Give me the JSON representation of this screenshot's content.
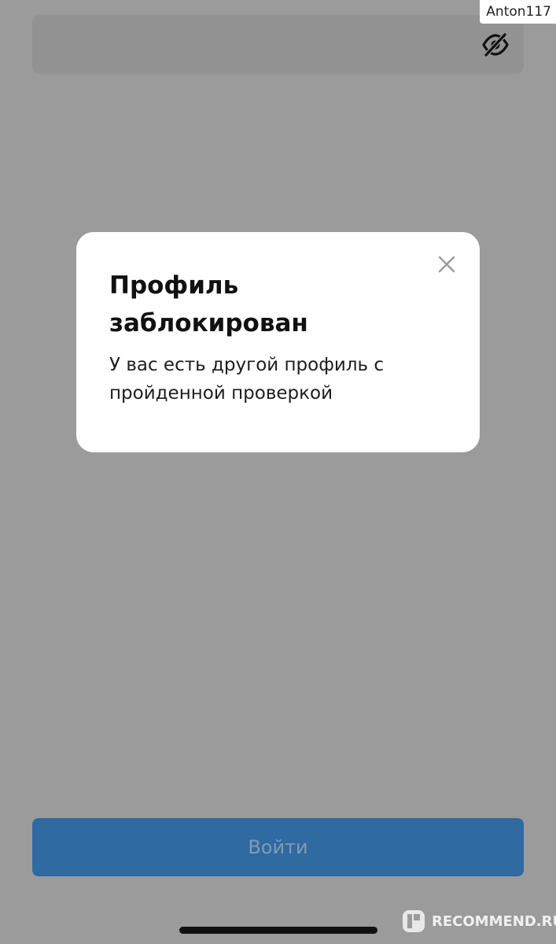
{
  "watermark": {
    "username": "Anton117",
    "brand": "RECOMMEND.RU"
  },
  "password_field": {
    "icon": "eye-slash-icon"
  },
  "modal": {
    "title": "Профиль заблокирован",
    "message": "У вас есть другой профиль с пройденной проверкой",
    "close_icon": "close-icon"
  },
  "login_button": {
    "label": "Войти"
  },
  "colors": {
    "overlay_background": "#9b9b9b",
    "button_background": "#2f6aa1",
    "modal_background": "#ffffff"
  }
}
